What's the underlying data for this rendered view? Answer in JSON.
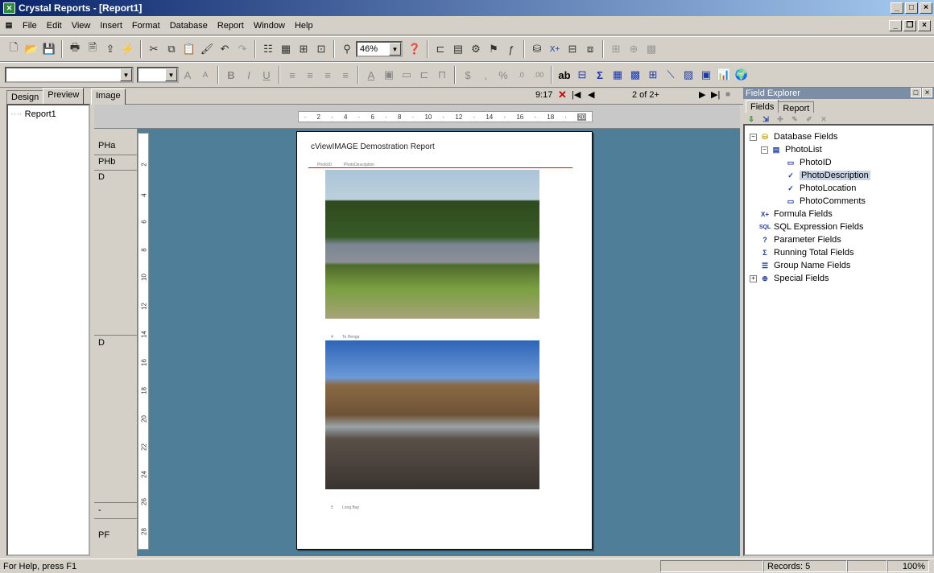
{
  "window": {
    "title": "Crystal Reports - [Report1]"
  },
  "menu": {
    "items": [
      "File",
      "Edit",
      "View",
      "Insert",
      "Format",
      "Database",
      "Report",
      "Window",
      "Help"
    ]
  },
  "toolbar": {
    "zoom": "46%"
  },
  "left_panel": {
    "tabs": [
      "Design",
      "Preview",
      "Image"
    ],
    "tree_item": "Report1"
  },
  "nav": {
    "time": "9:17",
    "page": "2 of 2+"
  },
  "ruler": {
    "ticks": [
      "2",
      "4",
      "6",
      "8",
      "10",
      "12",
      "14",
      "16",
      "18",
      "20"
    ]
  },
  "vruler": {
    "ticks": [
      "2",
      "4",
      "6",
      "8",
      "10",
      "12",
      "14",
      "16",
      "18",
      "20",
      "22",
      "24",
      "26",
      "28"
    ]
  },
  "sections": {
    "pha": "PHa",
    "phb": "PHb",
    "d1": "D",
    "d2": "D",
    "dash": "-",
    "pf": "PF"
  },
  "report": {
    "title": "cViewIMAGE Demostration Report",
    "col1": "PhotoID",
    "col2": "PhotoDescription",
    "rows": [
      {
        "id": "4",
        "desc": "Te Henga"
      },
      {
        "id": "5",
        "desc": "Long Bay"
      }
    ]
  },
  "field_explorer": {
    "title": "Field Explorer",
    "tabs": [
      "Fields",
      "Report"
    ],
    "database_fields": "Database Fields",
    "table": "PhotoList",
    "fields": [
      "PhotoID",
      "PhotoDescription",
      "PhotoLocation",
      "PhotoComments"
    ],
    "selected": "PhotoDescription",
    "others": [
      "Formula Fields",
      "SQL Expression Fields",
      "Parameter Fields",
      "Running Total Fields",
      "Group Name Fields",
      "Special Fields"
    ]
  },
  "status": {
    "help": "For Help, press F1",
    "records": "Records: 5",
    "zoom": "100%"
  }
}
